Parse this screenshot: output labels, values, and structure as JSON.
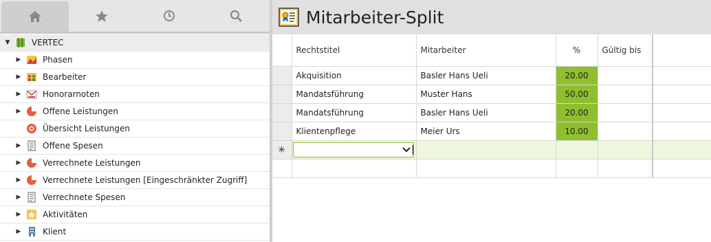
{
  "toolbar": {
    "items": [
      {
        "name": "home-icon",
        "glyph": "⌂"
      },
      {
        "name": "star-icon",
        "glyph": "★"
      },
      {
        "name": "clock-icon",
        "glyph": "◷"
      },
      {
        "name": "search-icon",
        "glyph": "⚲"
      }
    ]
  },
  "tree": {
    "root": "VERTEC",
    "items": [
      {
        "label": "Phasen",
        "expandable": true,
        "icon": "phases-icon"
      },
      {
        "label": "Bearbeiter",
        "expandable": true,
        "icon": "users-icon"
      },
      {
        "label": "Honorarnoten",
        "expandable": true,
        "icon": "invoice-icon"
      },
      {
        "label": "Offene Leistungen",
        "expandable": true,
        "icon": "pie-icon"
      },
      {
        "label": "Übersicht Leistungen",
        "expandable": false,
        "icon": "overview-icon"
      },
      {
        "label": "Offene Spesen",
        "expandable": true,
        "icon": "receipt-icon"
      },
      {
        "label": "Verrechnete Leistungen",
        "expandable": true,
        "icon": "pie-icon"
      },
      {
        "label": "Verrechnete Leistungen [Eingeschränkter Zugriff]",
        "expandable": true,
        "icon": "pie-icon"
      },
      {
        "label": "Verrechnete Spesen",
        "expandable": true,
        "icon": "receipt-icon"
      },
      {
        "label": "Aktivitäten",
        "expandable": true,
        "icon": "activity-icon"
      },
      {
        "label": "Klient",
        "expandable": true,
        "icon": "building-icon"
      }
    ]
  },
  "main": {
    "title": "Mitarbeiter-Split",
    "columns": [
      "Rechtstitel",
      "Mitarbeiter",
      "%",
      "Gültig bis"
    ],
    "rows": [
      {
        "rechtstitel": "Akquisition",
        "mitarbeiter": "Basler Hans Ueli",
        "pct": "20.00",
        "gueltig": ""
      },
      {
        "rechtstitel": "Mandatsführung",
        "mitarbeiter": "Muster Hans",
        "pct": "50.00",
        "gueltig": ""
      },
      {
        "rechtstitel": "Mandatsführung",
        "mitarbeiter": "Basler Hans Ueli",
        "pct": "20.00",
        "gueltig": ""
      },
      {
        "rechtstitel": "Klientenpflege",
        "mitarbeiter": "Meier Urs",
        "pct": "10.00",
        "gueltig": ""
      }
    ],
    "new_row_marker": "✳"
  },
  "colors": {
    "accent_green": "#8fbf2f",
    "new_row": "#eef6dd"
  }
}
